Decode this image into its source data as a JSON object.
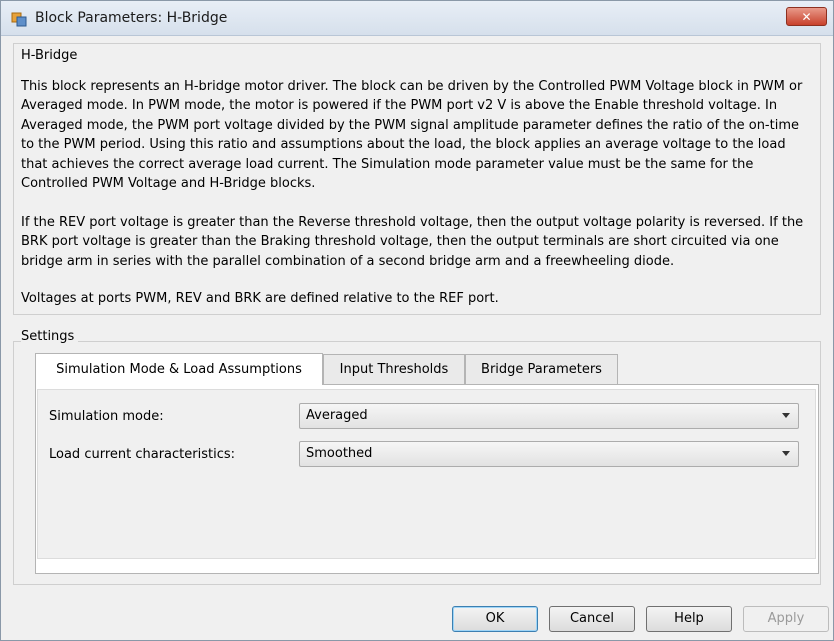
{
  "window": {
    "title": "Block Parameters: H-Bridge",
    "close_label": "✕"
  },
  "description": {
    "group_label": "H-Bridge",
    "paragraphs": [
      "This block represents an H-bridge motor driver. The block can be driven by the Controlled PWM Voltage block in PWM or Averaged mode. In PWM mode, the motor is powered if the PWM port v2 V is above the Enable threshold voltage. In Averaged mode, the PWM port voltage divided by the PWM signal amplitude parameter defines the ratio of the on-time to the PWM period. Using this ratio and assumptions about the load, the block applies an average voltage to the load that achieves the correct average load current. The Simulation mode parameter value must be the same for the Controlled PWM Voltage and H-Bridge blocks.",
      "If the REV port voltage is greater than the Reverse threshold voltage, then the output voltage polarity is reversed. If the BRK port voltage is greater than the Braking threshold voltage, then the output terminals are short circuited via one bridge arm in series with the parallel combination of a second bridge arm and a freewheeling diode.",
      "Voltages at ports PWM, REV and BRK are defined relative to the REF port."
    ]
  },
  "settings": {
    "group_label": "Settings",
    "tabs": [
      {
        "label": "Simulation Mode & Load Assumptions",
        "active": true
      },
      {
        "label": "Input Thresholds",
        "active": false
      },
      {
        "label": "Bridge Parameters",
        "active": false
      }
    ],
    "fields": [
      {
        "label": "Simulation mode:",
        "value": "Averaged"
      },
      {
        "label": "Load current characteristics:",
        "value": "Smoothed"
      }
    ]
  },
  "buttons": {
    "ok": "OK",
    "cancel": "Cancel",
    "help": "Help",
    "apply": "Apply"
  },
  "colors": {
    "window_bg": "#f0f0f0",
    "close_button": "#c8412c",
    "default_button_border": "#3c7fb1"
  }
}
